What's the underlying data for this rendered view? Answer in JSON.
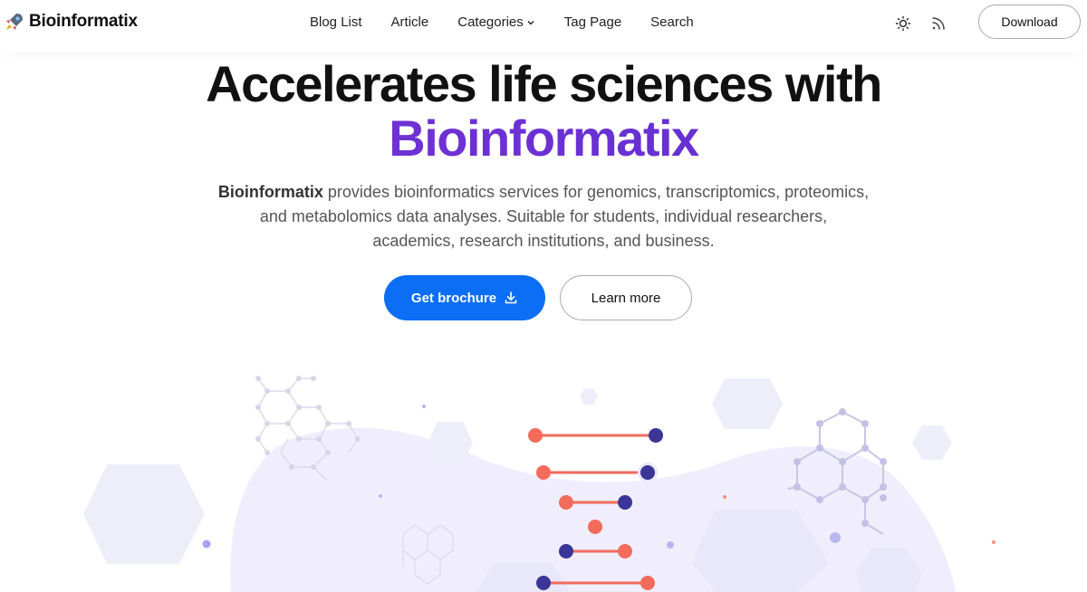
{
  "header": {
    "brand": "Bioinformatix",
    "nav": [
      {
        "label": "Blog List"
      },
      {
        "label": "Article"
      },
      {
        "label": "Categories"
      },
      {
        "label": "Tag Page"
      },
      {
        "label": "Search"
      }
    ],
    "download_label": "Download"
  },
  "hero": {
    "title_line1": "Accelerates life sciences with",
    "title_line2": "Bioinformatix",
    "desc_brand": "Bioinformatix",
    "desc_rest": " provides bioinformatics services for genomics, transcriptomics, proteomics, and metabolomics data analyses. Suitable for students, individual researchers, academics, research institutions, and business.",
    "primary_label": "Get brochure",
    "secondary_label": "Learn more"
  },
  "colors": {
    "accent": "#6d2ed9",
    "primary_button": "#0b6ef4",
    "dna_coral": "#f26b5b",
    "dna_navy": "#3a3596",
    "hex_light": "#eeeefb"
  },
  "icons": [
    "rocket-icon",
    "chevron-down-icon",
    "sun-icon",
    "rss-icon",
    "download-icon"
  ]
}
